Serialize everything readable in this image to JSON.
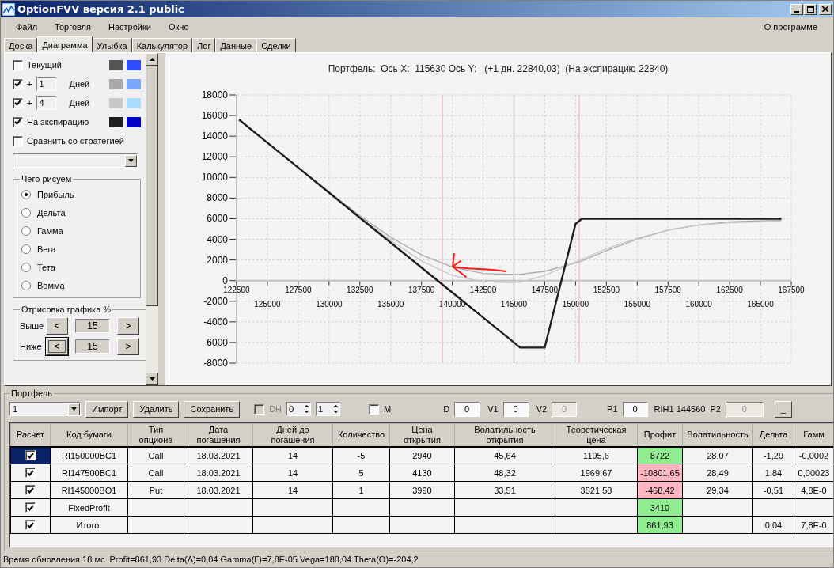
{
  "window": {
    "title": "OptionFVV версия 2.1 public"
  },
  "menu": {
    "items": [
      "Файл",
      "Торговля",
      "Настройки",
      "Окно"
    ],
    "about": "О программе"
  },
  "tabs": [
    {
      "label": "Доска",
      "selected": false
    },
    {
      "label": "Диаграмма",
      "selected": true
    },
    {
      "label": "Улыбка",
      "selected": false
    },
    {
      "label": "Калькулятор",
      "selected": false
    },
    {
      "label": "Лог",
      "selected": false
    },
    {
      "label": "Данные",
      "selected": false
    },
    {
      "label": "Сделки",
      "selected": false
    }
  ],
  "sidebar": {
    "curves": [
      {
        "kind": "plain",
        "label": "Текущий",
        "checked": false,
        "swatches": [
          {
            "color": "#555555"
          },
          {
            "color": "#2b4eff"
          }
        ]
      },
      {
        "kind": "days",
        "prefix": "+",
        "value": "1",
        "unit": "Дней",
        "checked": true,
        "swatches": [
          {
            "color": "#a9a9a9"
          },
          {
            "color": "#7aa7ff"
          }
        ]
      },
      {
        "kind": "days",
        "prefix": "+",
        "value": "4",
        "unit": "Дней",
        "checked": true,
        "swatches": [
          {
            "color": "#c8c8c8"
          },
          {
            "color": "#a9dcff"
          }
        ]
      },
      {
        "kind": "plain",
        "label": "На экспирацию",
        "checked": true,
        "swatches": [
          {
            "color": "#1e1e1e"
          },
          {
            "color": "#0000c8"
          }
        ]
      },
      {
        "kind": "plain",
        "label": "Сравнить со стратегией",
        "checked": false
      }
    ],
    "draw_group": {
      "title": "Чего рисуем",
      "options": [
        {
          "label": "Прибыль",
          "selected": true
        },
        {
          "label": "Дельта",
          "selected": false
        },
        {
          "label": "Гамма",
          "selected": false
        },
        {
          "label": "Вега",
          "selected": false
        },
        {
          "label": "Тета",
          "selected": false
        },
        {
          "label": "Вомма",
          "selected": false
        }
      ]
    },
    "range_group": {
      "title": "Отрисовка графика %",
      "rows": [
        {
          "label": "Выше",
          "prev": "<",
          "value": "15",
          "next": ">",
          "focused": false
        },
        {
          "label": "Ниже",
          "prev": "<",
          "value": "15",
          "next": ">",
          "focused": true
        }
      ]
    }
  },
  "chart": {
    "chart_data": {
      "type": "line",
      "title": "Портфель:  Ось X:  115630 Ось Y:   (+1 дн. 22840,03)  (На экспирацию 22840)",
      "x": [
        122700,
        125000,
        127500,
        130000,
        132500,
        135000,
        137500,
        140000,
        142500,
        145000,
        145500,
        147500,
        150000,
        150500,
        152500,
        155000,
        157500,
        160000,
        162500,
        165000,
        166700
      ],
      "grid": true,
      "series": [
        {
          "color": "#a9a9a9",
          "values": [
            15600,
            13370,
            10960,
            8600,
            6300,
            4200,
            2500,
            1300,
            700,
            600,
            620,
            900,
            1700,
            1900,
            2900,
            4000,
            4900,
            5400,
            5700,
            5800,
            5850
          ]
        },
        {
          "color": "#c8c8c8",
          "values": [
            15600,
            13370,
            10950,
            8550,
            6200,
            3900,
            1900,
            500,
            -100,
            -200,
            -150,
            500,
            1800,
            2050,
            3100,
            4100,
            4900,
            5400,
            5600,
            5700,
            5800
          ]
        },
        {
          "color": "#1e1e1e",
          "values": [
            15600,
            13370,
            10950,
            8530,
            6100,
            3680,
            1260,
            -1160,
            -3580,
            -6000,
            -6500,
            -6500,
            5500,
            6000,
            6000,
            6000,
            6000,
            6000,
            6000,
            6000,
            6000
          ]
        }
      ],
      "xlim": [
        122500,
        167500
      ],
      "ylim": [
        -8000,
        18000
      ],
      "xticks": [
        122500,
        127500,
        132500,
        137500,
        142500,
        147500,
        152500,
        157500,
        162500,
        167500
      ],
      "annotations": [
        "125000",
        "130000",
        "135000",
        "140000",
        "145000",
        "150000",
        "155000",
        "160000",
        "165000"
      ],
      "yticks": [
        -8000,
        -6000,
        -4000,
        -2000,
        0,
        2000,
        4000,
        6000,
        8000,
        10000,
        12000,
        14000,
        16000,
        18000
      ],
      "ref_lines": [
        {
          "axis": "x",
          "value": 139200,
          "color": "#ffb6b6"
        },
        {
          "axis": "x",
          "value": 145000,
          "color": "#7a8599"
        },
        {
          "axis": "x",
          "value": 150300,
          "color": "#ffb6b6"
        }
      ]
    }
  },
  "portfolio": {
    "title": "Портфель",
    "select": "1",
    "buttons": [
      "Импорт",
      "Удалить",
      "Сохранить"
    ],
    "dh": {
      "label": "DH",
      "checked": false,
      "disabled": true
    },
    "spinners": [
      "0",
      "1"
    ],
    "m": {
      "label": "M",
      "checked": false,
      "disabled": false
    },
    "fields": [
      {
        "label": "D",
        "value": "0",
        "disabled": false
      },
      {
        "label": "V1",
        "value": "0",
        "disabled": false
      },
      {
        "label": "V2",
        "value": "0",
        "disabled": true
      },
      {
        "label": "P1",
        "value": "0",
        "disabled": false
      }
    ],
    "ticker": "RIH1 144560",
    "p2": {
      "label": "P2",
      "value": "0",
      "disabled": true
    },
    "small_button": "_",
    "table": {
      "columns": [
        "Расчет",
        "Код бумаги",
        "Тип\nопциона",
        "Дата\nпогашения",
        "Дней до\nпогашения",
        "Количество",
        "Цена\nоткрытия",
        "Волатильность\nоткрытия",
        "Теоретическая\nцена",
        "Профит",
        "Волатильность",
        "Дельта",
        "Гамм"
      ],
      "rows": [
        {
          "checked": true,
          "selected": true,
          "color": "#90ee90",
          "cells": [
            "",
            "RI150000BC1",
            "Call",
            "18.03.2021",
            "14",
            "-5",
            "2940",
            "45,64",
            "1195,6",
            "8722",
            "28,07",
            "-1,29",
            "-0,0002"
          ]
        },
        {
          "checked": true,
          "selected": false,
          "color": "#ffb6c1",
          "cells": [
            "",
            "RI147500BC1",
            "Call",
            "18.03.2021",
            "14",
            "5",
            "4130",
            "48,32",
            "1969,67",
            "-10801,65",
            "28,49",
            "1,84",
            "0,00023"
          ]
        },
        {
          "checked": true,
          "selected": false,
          "color": "#ffb6c1",
          "cells": [
            "",
            "RI145000BO1",
            "Put",
            "18.03.2021",
            "14",
            "1",
            "3990",
            "33,51",
            "3521,58",
            "-468,42",
            "29,34",
            "-0,51",
            "4,8E-0"
          ]
        },
        {
          "checked": true,
          "selected": false,
          "color": "#90ee90",
          "cells": [
            "",
            "FixedProfit",
            "",
            "",
            "",
            "",
            "",
            "",
            "",
            "3410",
            "",
            "",
            ""
          ]
        },
        {
          "checked": true,
          "selected": false,
          "color": "#90ee90",
          "cells": [
            "",
            "Итого:",
            "",
            "",
            "",
            "",
            "",
            "",
            "",
            "861,93",
            "",
            "0,04",
            "7,8E-0"
          ]
        }
      ]
    }
  },
  "status_bar": {
    "update": "Время обновления 18 мс",
    "summary": "Profit=861,93 Delta(Δ)=0,04 Gamma(Γ)=7,8E-05 Vega=188,04 Theta(Θ)=-204,2"
  }
}
